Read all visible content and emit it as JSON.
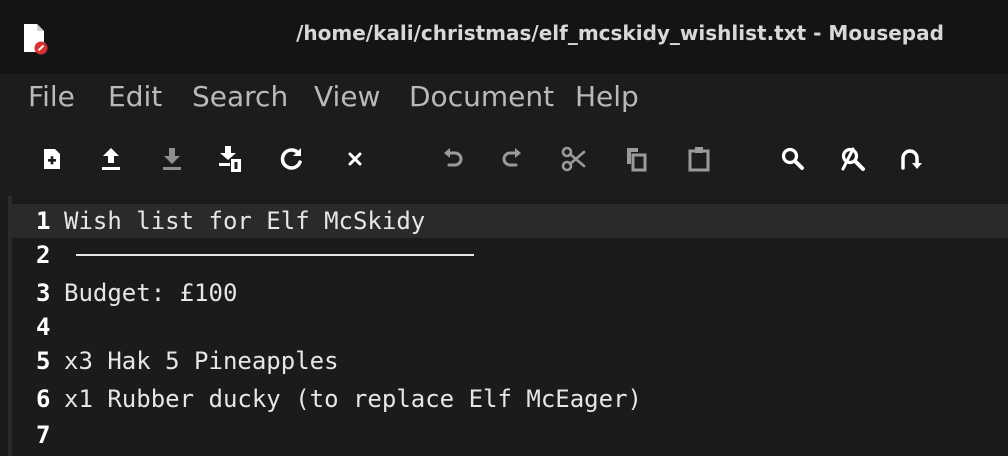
{
  "window": {
    "title": "/home/kali/christmas/elf_mcskidy_wishlist.txt - Mousepad"
  },
  "menu": [
    {
      "label": "File"
    },
    {
      "label": "Edit"
    },
    {
      "label": "Search"
    },
    {
      "label": "View"
    },
    {
      "label": "Document"
    },
    {
      "label": "Help"
    }
  ],
  "toolbar": [
    {
      "icon": "new-document-icon"
    },
    {
      "icon": "open-upload-icon"
    },
    {
      "icon": "save-download-icon"
    },
    {
      "icon": "save-as-icon"
    },
    {
      "icon": "reload-icon"
    },
    {
      "icon": "close-icon"
    },
    {
      "icon": "undo-icon"
    },
    {
      "icon": "redo-icon"
    },
    {
      "icon": "cut-icon"
    },
    {
      "icon": "copy-icon"
    },
    {
      "icon": "paste-icon"
    },
    {
      "icon": "find-icon"
    },
    {
      "icon": "find-replace-icon"
    },
    {
      "icon": "go-to-line-icon"
    }
  ],
  "editor": {
    "current_line": 1,
    "lines": [
      {
        "number": "1",
        "text": "Wish list for Elf McSkidy"
      },
      {
        "number": "2",
        "text": ""
      },
      {
        "number": "3",
        "text": "Budget: £100"
      },
      {
        "number": "4",
        "text": ""
      },
      {
        "number": "5",
        "text": "x3 Hak 5 Pineapples"
      },
      {
        "number": "6",
        "text": "x1 Rubber ducky (to replace Elf McEager)"
      },
      {
        "number": "7",
        "text": ""
      }
    ]
  },
  "colors": {
    "titlebar_bg": "#141414",
    "app_bg": "#1c1c1c",
    "editor_bg": "#1b1b1b",
    "current_line_bg": "#2a2a2a",
    "icon_fill": "#ffffff",
    "icon_red": "#d93131"
  }
}
